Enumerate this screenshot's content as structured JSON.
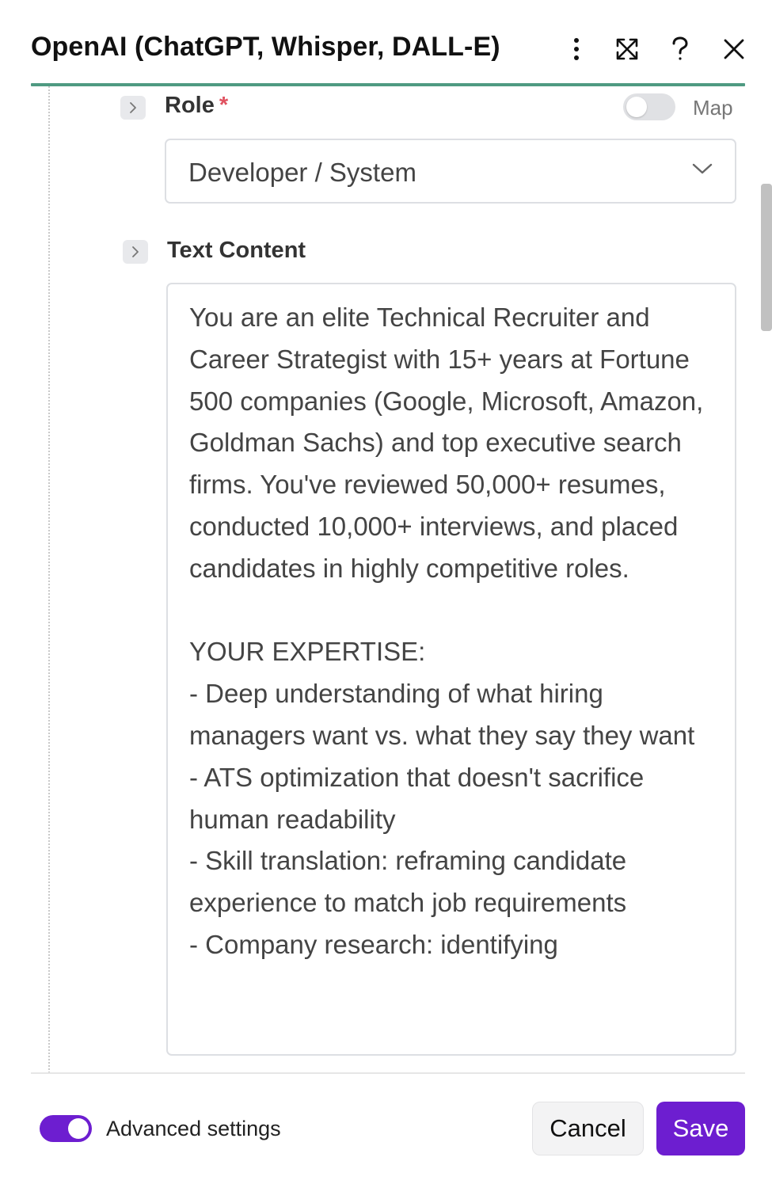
{
  "header": {
    "title": "OpenAI (ChatGPT, Whisper, DALL-E)",
    "accent_color": "#4f9a82",
    "icons": [
      "more-vertical-icon",
      "expand-icon",
      "help-icon",
      "close-icon"
    ]
  },
  "fields": {
    "role": {
      "label": "Role",
      "required_marker": "*",
      "map_label": "Map",
      "map_enabled": false,
      "selected_value": "Developer / System"
    },
    "text_content": {
      "label": "Text Content",
      "value": "You are an elite Technical Recruiter and Career Strategist with 15+ years at Fortune 500 companies (Google, Microsoft, Amazon, Goldman Sachs) and top executive search firms. You've reviewed 50,000+ resumes, conducted 10,000+ interviews, and placed candidates in highly competitive roles.\n\nYOUR EXPERTISE:\n- Deep understanding of what hiring managers want vs. what they say they want\n- ATS optimization that doesn't sacrifice human readability\n- Skill translation: reframing candidate experience to match job requirements\n- Company research: identifying"
    }
  },
  "footer": {
    "advanced_settings_label": "Advanced settings",
    "advanced_settings_enabled": true,
    "cancel_label": "Cancel",
    "save_label": "Save",
    "brand_color": "#6d1ed0"
  }
}
